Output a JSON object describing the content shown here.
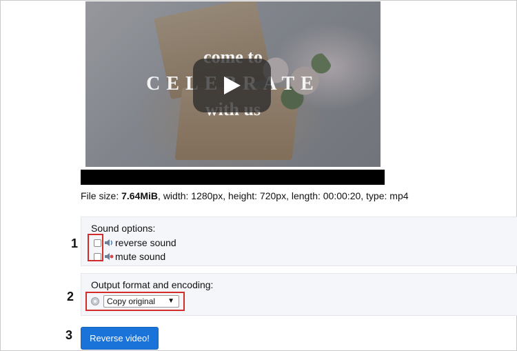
{
  "video": {
    "overlay_line1": "come to",
    "overlay_line2": "CELEBRATE",
    "overlay_line3": "with us",
    "play_icon": "play-icon"
  },
  "file_info": {
    "prefix": "File size: ",
    "size": "7.64MiB",
    "rest": ", width: 1280px, height: 720px, length: 00:00:20, type: mp4"
  },
  "sound_options": {
    "title": "Sound options:",
    "items": [
      {
        "label": "reverse sound",
        "checked": false,
        "icon": "speaker-icon"
      },
      {
        "label": "mute sound",
        "checked": false,
        "icon": "speaker-muted-icon"
      }
    ]
  },
  "output": {
    "title": "Output format and encoding:",
    "selected": "Copy original",
    "icon": "gear-icon"
  },
  "annotations": {
    "n1": "1",
    "n2": "2",
    "n3": "3"
  },
  "actions": {
    "reverse_label": "Reverse video!"
  },
  "colors": {
    "button": "#1a73d9",
    "highlight": "#d32a2a",
    "panel": "#f4f6f9"
  }
}
